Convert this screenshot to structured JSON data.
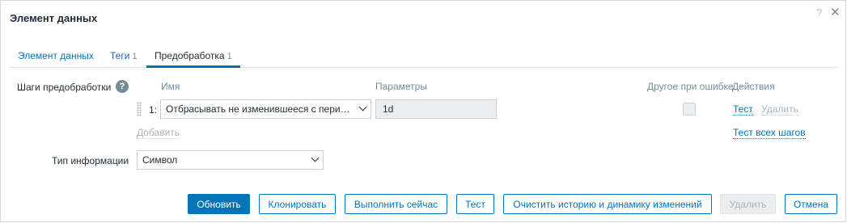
{
  "dialog": {
    "title": "Элемент данных",
    "help_icon": "?",
    "close_icon": "✕"
  },
  "tabs": [
    {
      "label": "Элемент данных",
      "count": ""
    },
    {
      "label": "Теги",
      "count": "1"
    },
    {
      "label": "Предобработка",
      "count": "1",
      "active": true
    }
  ],
  "preprocessing": {
    "label": "Шаги предобработки",
    "help": "?",
    "headers": {
      "name": "Имя",
      "params": "Параметры",
      "on_error": "Другое при ошибке",
      "actions": "Действия"
    },
    "steps": [
      {
        "index": "1:",
        "name": "Отбрасывать не изменившееся с перио…",
        "param": "1d",
        "on_error_checked": false,
        "test": "Тест",
        "delete": "Удалить"
      }
    ],
    "add": "Добавить",
    "test_all": "Тест всех шагов"
  },
  "info_type": {
    "label": "Тип информации",
    "value": "Символ"
  },
  "buttons": {
    "update": "Обновить",
    "clone": "Клонировать",
    "execute_now": "Выполнить сейчас",
    "test": "Тест",
    "clear_history": "Очистить историю и динамику изменений",
    "delete": "Удалить",
    "cancel": "Отмена"
  },
  "colors": {
    "accent": "#0275b8",
    "text": "#1f2c33",
    "muted": "#768d99"
  }
}
